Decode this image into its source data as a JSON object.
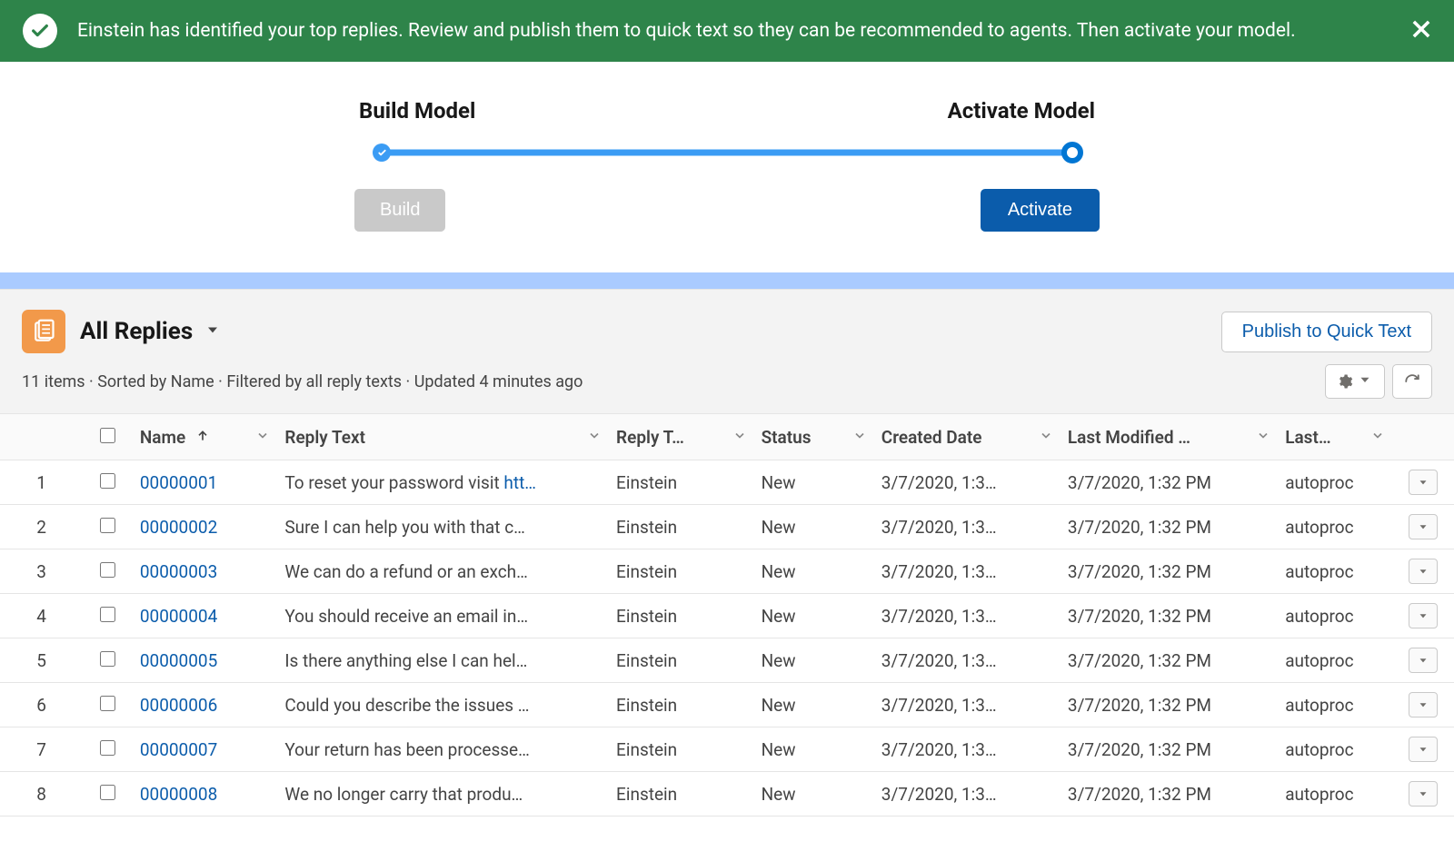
{
  "banner": {
    "text": "Einstein has identified your top replies. Review and publish them to quick text so they can be recommended to agents. Then activate your model."
  },
  "stage": {
    "left_label": "Build Model",
    "right_label": "Activate Model",
    "build_btn": "Build",
    "activate_btn": "Activate"
  },
  "list": {
    "title": "All Replies",
    "publish_btn": "Publish to Quick Text",
    "subtext": "11 items · Sorted by Name · Filtered by all reply texts · Updated 4 minutes ago"
  },
  "columns": {
    "name": "Name",
    "reply_text": "Reply Text",
    "reply_t": "Reply T…",
    "status": "Status",
    "created": "Created Date",
    "modified": "Last Modified …",
    "last": "Last…"
  },
  "rows": [
    {
      "num": "1",
      "name": "00000001",
      "reply": "To reset your password visit htt…",
      "replyt": "Einstein",
      "status": "New",
      "created": "3/7/2020, 1:3…",
      "modified": "3/7/2020, 1:32 PM",
      "last": "autoproc"
    },
    {
      "num": "2",
      "name": "00000002",
      "reply": "Sure I can help you with that c…",
      "replyt": "Einstein",
      "status": "New",
      "created": "3/7/2020, 1:3…",
      "modified": "3/7/2020, 1:32 PM",
      "last": "autoproc"
    },
    {
      "num": "3",
      "name": "00000003",
      "reply": "We can do a refund or an exch…",
      "replyt": "Einstein",
      "status": "New",
      "created": "3/7/2020, 1:3…",
      "modified": "3/7/2020, 1:32 PM",
      "last": "autoproc"
    },
    {
      "num": "4",
      "name": "00000004",
      "reply": "You should receive an email in…",
      "replyt": "Einstein",
      "status": "New",
      "created": "3/7/2020, 1:3…",
      "modified": "3/7/2020, 1:32 PM",
      "last": "autoproc"
    },
    {
      "num": "5",
      "name": "00000005",
      "reply": "Is there anything else I can hel…",
      "replyt": "Einstein",
      "status": "New",
      "created": "3/7/2020, 1:3…",
      "modified": "3/7/2020, 1:32 PM",
      "last": "autoproc"
    },
    {
      "num": "6",
      "name": "00000006",
      "reply": "Could you describe the issues …",
      "replyt": "Einstein",
      "status": "New",
      "created": "3/7/2020, 1:3…",
      "modified": "3/7/2020, 1:32 PM",
      "last": "autoproc"
    },
    {
      "num": "7",
      "name": "00000007",
      "reply": "Your return has been processe…",
      "replyt": "Einstein",
      "status": "New",
      "created": "3/7/2020, 1:3…",
      "modified": "3/7/2020, 1:32 PM",
      "last": "autoproc"
    },
    {
      "num": "8",
      "name": "00000008",
      "reply": "We no longer carry that produ…",
      "replyt": "Einstein",
      "status": "New",
      "created": "3/7/2020, 1:3…",
      "modified": "3/7/2020, 1:32 PM",
      "last": "autoproc"
    }
  ]
}
